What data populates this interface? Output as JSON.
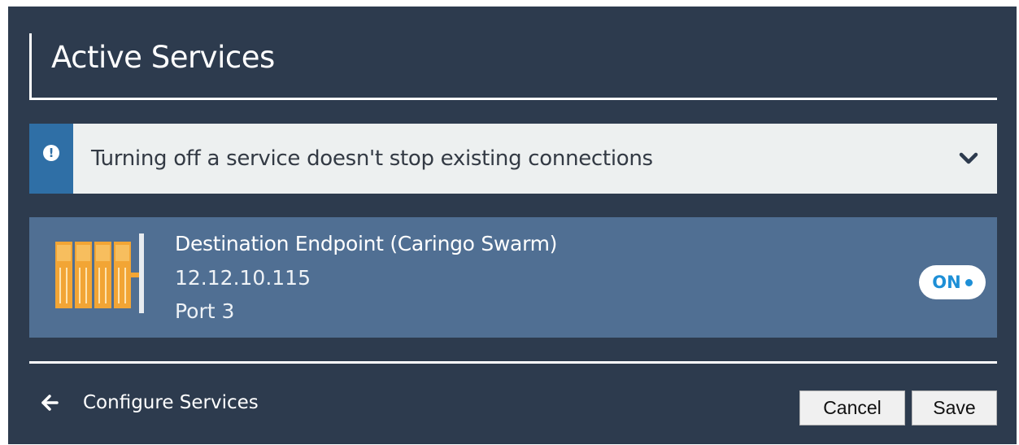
{
  "header": {
    "title": "Active Services"
  },
  "alert": {
    "icon": "exclamation-icon",
    "message": "Turning off a service doesn't stop existing connections",
    "expand_icon": "chevron-down-icon"
  },
  "service": {
    "icon": "server-rack-icon",
    "name": "Destination Endpoint (Caringo Swarm)",
    "ip": "12.12.10.115",
    "port": "Port 3",
    "toggle_label": "ON",
    "enabled": true
  },
  "footer": {
    "back_icon": "arrow-left-icon",
    "back_label": "Configure Services",
    "cancel_label": "Cancel",
    "save_label": "Save"
  },
  "colors": {
    "panel_bg": "#2d3b4e",
    "alert_bg": "#edf0f0",
    "alert_accent": "#2f6fa6",
    "service_bg": "#506f93",
    "toggle_accent": "#1e8fd6",
    "icon_orange": "#f2a535"
  }
}
